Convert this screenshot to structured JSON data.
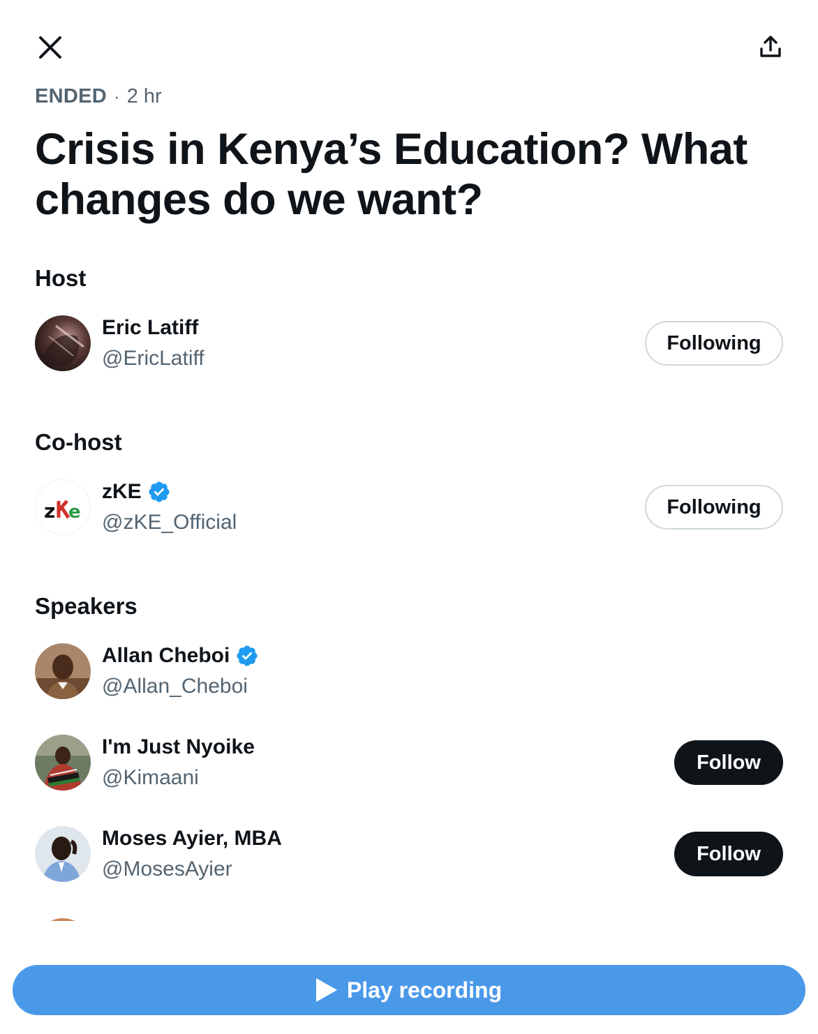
{
  "header": {
    "close_icon": "close-icon",
    "share_icon": "share-icon"
  },
  "space": {
    "status": "ENDED",
    "separator": "·",
    "time_ago": "2 hr",
    "title": "Crisis in Kenya’s Education? What changes do we want?"
  },
  "host": {
    "section_label": "Host",
    "name": "Eric Latiff",
    "handle": "@EricLatiff",
    "button_label": "Following"
  },
  "cohost": {
    "section_label": "Co-host",
    "name": "zKE",
    "verified": true,
    "handle": "@zKE_Official",
    "button_label": "Following",
    "avatar_text": "zke"
  },
  "speakers": {
    "section_label": "Speakers",
    "items": [
      {
        "name": "Allan Cheboi",
        "verified": true,
        "handle": "@Allan_Cheboi"
      },
      {
        "name": "I'm Just Nyoike",
        "verified": false,
        "handle": "@Kimaani",
        "button_label": "Follow"
      },
      {
        "name": "Moses Ayier, MBA",
        "verified": false,
        "handle": "@MosesAyier",
        "button_label": "Follow"
      }
    ]
  },
  "footer": {
    "play_label": "Play recording",
    "play_icon": "play-icon"
  },
  "colors": {
    "accent": "#4a99e9",
    "verified": "#1d9bf0",
    "text_primary": "#0f1419",
    "text_secondary": "#536471",
    "border": "#cfd9de"
  }
}
